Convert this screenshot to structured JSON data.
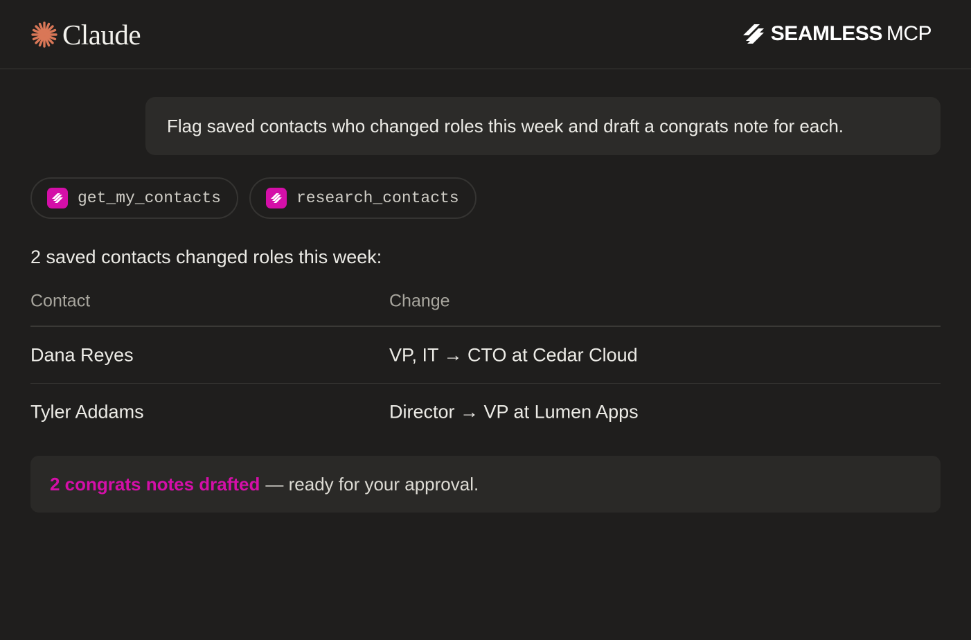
{
  "header": {
    "claude_label": "Claude",
    "seamless_label": "SEAMLESS",
    "mcp_label": "MCP",
    "claude_accent": "#d97757",
    "seamless_icon": "seamless-logo-icon"
  },
  "prompt": {
    "text": "Flag saved contacts who changed roles this week and draft a congrats note for each."
  },
  "tools": [
    {
      "name": "get_my_contacts",
      "icon": "seamless-icon",
      "icon_color": "#d40fa8"
    },
    {
      "name": "research_contacts",
      "icon": "seamless-icon",
      "icon_color": "#d40fa8"
    }
  ],
  "response": {
    "summary": "2 saved contacts changed roles this week:",
    "table": {
      "headers": [
        "Contact",
        "Change"
      ],
      "rows": [
        {
          "contact": "Dana Reyes",
          "change": "VP, IT → CTO at Cedar Cloud"
        },
        {
          "contact": "Tyler Addams",
          "change": "Director → VP at Lumen Apps"
        }
      ]
    },
    "callout": {
      "highlight": "2 congrats notes drafted",
      "rest": "— ready for your approval.",
      "highlight_color": "#d40fa8"
    }
  }
}
